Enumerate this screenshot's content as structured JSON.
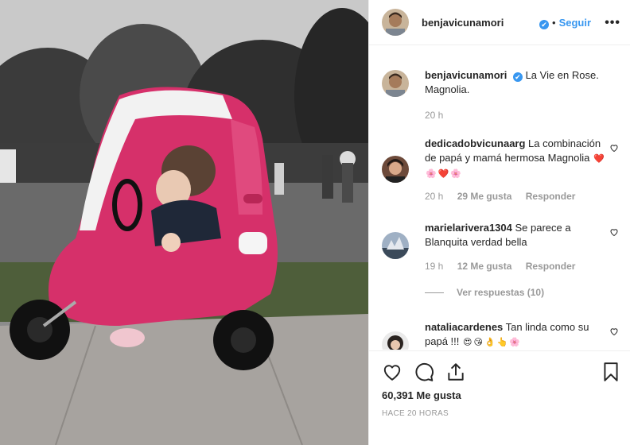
{
  "post": {
    "username": "benjavicunamori",
    "verified_mark": "✔",
    "separator": "•",
    "follow_label": "Seguir",
    "more_label": "•••",
    "caption": {
      "username": "benjavicunamori",
      "text": "La Vie en Rose. Magnolia.",
      "time": "20 h"
    },
    "comments": [
      {
        "username": "dedicadobvicunaarg",
        "text": "La combinación de papá y mamá hermosa Magnolia",
        "emojis": [
          "❤️",
          "🌸",
          "❤️",
          "🌸"
        ],
        "time": "20 h",
        "likes": "29 Me gusta",
        "reply": "Responder"
      },
      {
        "username": "marielarivera1304",
        "text": "Se parece a Blanquita verdad bella",
        "emojis": [],
        "time": "19 h",
        "likes": "12 Me gusta",
        "reply": "Responder"
      },
      {
        "username": "nataliacardenes",
        "text": "Tan linda como su papá !!!",
        "emojis": [
          "😍",
          "😘",
          "👌",
          "👆",
          "🌸"
        ],
        "time": "",
        "likes": "",
        "reply": ""
      }
    ],
    "view_replies": "Ver respuestas (10)",
    "likes_count": "60,391 Me gusta",
    "posted": "HACE 20 HORAS"
  },
  "icons": [
    "heart-icon",
    "comment-icon",
    "share-icon",
    "bookmark-icon"
  ],
  "colors": {
    "accent": "#3897f0",
    "car_pink": "#e0306a",
    "muted": "#999999"
  }
}
